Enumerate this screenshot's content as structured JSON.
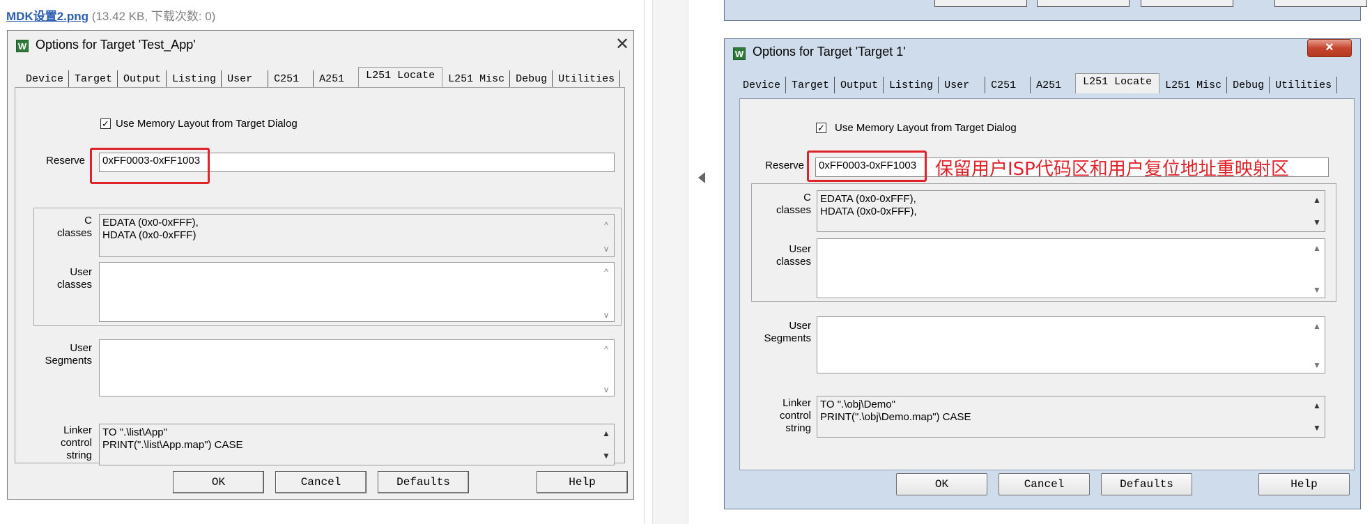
{
  "header": {
    "file_name": "MDK设置2.png",
    "file_meta": "(13.42 KB, 下载次数: 0)"
  },
  "left_dialog": {
    "title": "Options for Target 'Test_App'",
    "tabs": [
      "Device",
      "Target",
      "Output",
      "Listing",
      "User",
      "C251",
      "A251",
      "L251 Locate",
      "L251 Misc",
      "Debug",
      "Utilities"
    ],
    "active_tab": "L251 Locate",
    "use_memory_layout_label": "Use Memory Layout from Target Dialog",
    "reserve_label": "Reserve",
    "reserve_value": "0xFF0003-0xFF1003",
    "c_classes_label": "C\nclasses",
    "c_classes_lines": [
      "EDATA (0x0-0xFFF),",
      "HDATA (0x0-0xFFF)"
    ],
    "user_classes_label": "User\nclasses",
    "user_segments_label": "User\nSegments",
    "linker_label": "Linker\ncontrol\nstring",
    "linker_lines": [
      "TO \".\\list\\App\"",
      "PRINT(\".\\list\\App.map\") CASE"
    ],
    "buttons": {
      "ok": "OK",
      "cancel": "Cancel",
      "defaults": "Defaults",
      "help": "Help"
    }
  },
  "right_dialog": {
    "title": "Options for Target 'Target 1'",
    "tabs": [
      "Device",
      "Target",
      "Output",
      "Listing",
      "User",
      "C251",
      "A251",
      "L251 Locate",
      "L251 Misc",
      "Debug",
      "Utilities"
    ],
    "active_tab": "L251 Locate",
    "use_memory_layout_label": "Use Memory Layout from Target Dialog",
    "reserve_label": "Reserve",
    "reserve_value": "0xFF0003-0xFF1003",
    "annotation": "保留用户ISP代码区和用户复位地址重映射区",
    "c_classes_label": "C\nclasses",
    "c_classes_lines": [
      "EDATA (0x0-0xFFF),",
      "HDATA (0x0-0xFFF),"
    ],
    "user_classes_label": "User\nclasses",
    "user_segments_label": "User\nSegments",
    "linker_label": "Linker\ncontrol\nstring",
    "linker_lines": [
      "TO \".\\obj\\Demo\"",
      "PRINT(\".\\obj\\Demo.map\") CASE"
    ],
    "buttons": {
      "ok": "OK",
      "cancel": "Cancel",
      "defaults": "Defaults",
      "help": "Help"
    }
  },
  "colors": {
    "highlight_red": "#e0232a",
    "link_blue": "#2a5db0",
    "aero_frame": "#cfdcec"
  },
  "icons": [
    "uvision-target-icon",
    "close-icon",
    "checkbox-checked-icon",
    "scroll-up-icon",
    "scroll-down-icon",
    "collapse-arrow-icon"
  ]
}
